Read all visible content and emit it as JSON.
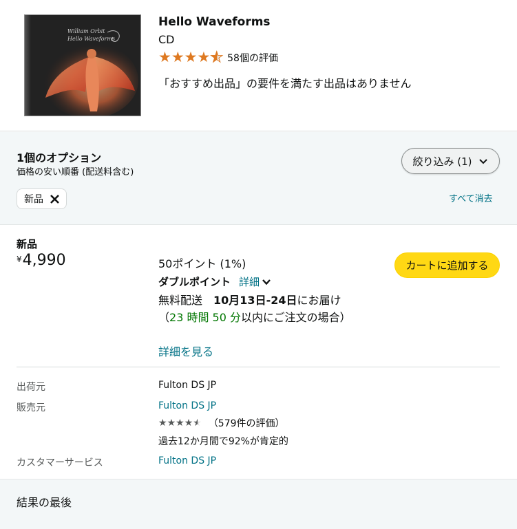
{
  "product": {
    "cover_text_line1": "William Orbit",
    "cover_text_line2": "Hello Waveforms",
    "title": "Hello Waveforms",
    "format": "CD",
    "rating_stars": 4.5,
    "rating_count": "58個の評価",
    "no_featured_offer": "「おすすめ出品」の要件を満たす出品はありません"
  },
  "options": {
    "count_label": "1個のオプション",
    "sort_label": "価格の安い順番 (配送料含む)",
    "filter_button": "絞り込み (1)",
    "active_filter_chip": "新品",
    "clear_all": "すべて消去"
  },
  "offer": {
    "condition": "新品",
    "currency_symbol": "¥",
    "price": "4,990",
    "points": "50ポイント (1%)",
    "add_to_cart": "カートに追加する",
    "double_points": "ダブルポイント",
    "details_toggle": "詳細",
    "free_shipping": "無料配送",
    "delivery_dates": "10月13日-24日",
    "delivery_suffix": "にお届け",
    "order_within_prefix": "（",
    "order_within_time": "23 時間 50 分",
    "order_within_suffix": "以内にご注文の場合）",
    "see_details": "詳細を見る",
    "ships_from_label": "出荷元",
    "ships_from_value": "Fulton DS JP",
    "sold_by_label": "販売元",
    "sold_by_value": "Fulton DS JP",
    "seller_stars": 4.5,
    "seller_rating_count": "（579件の評価）",
    "positive_rate": "過去12か月間で92%が肯定的",
    "customer_service_label": "カスタマーサービス",
    "customer_service_value": "Fulton DS JP"
  },
  "footer": {
    "end_of_results": "結果の最後"
  },
  "colors": {
    "star_orange": "#de7921",
    "link_teal": "#007185",
    "cart_yellow": "#ffd814",
    "green": "#007600",
    "panel_bg": "#f3f7f8"
  }
}
